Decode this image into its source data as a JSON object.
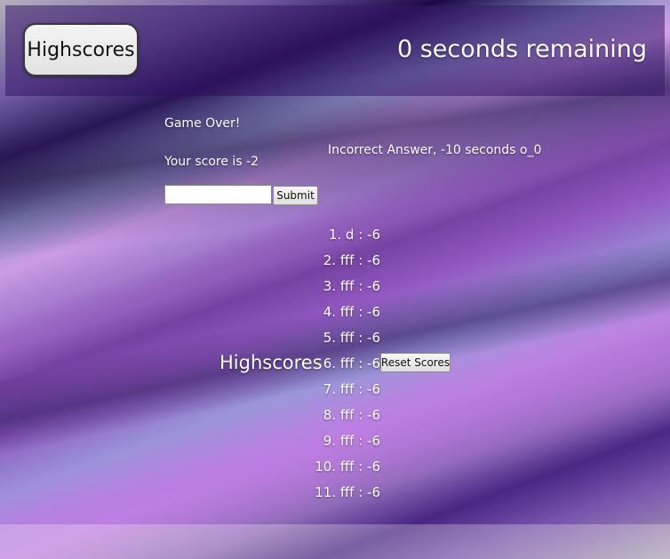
{
  "header": {
    "highscores_button": "Highscores",
    "timer_text": "0 seconds remaining"
  },
  "game": {
    "status": "Game Over!",
    "score_text": "Your score is -2",
    "feedback": "Incorrect Answer, -10 seconds o_0",
    "name_input_value": "",
    "submit_label": "Submit"
  },
  "highscores": {
    "title": "Highscores",
    "reset_label": "Reset Scores",
    "entries": [
      "1. d : -6",
      "2. fff : -6",
      "3. fff : -6",
      "4. fff : -6",
      "5. fff : -6",
      "6. fff : -6",
      "7. fff : -6",
      "8. fff : -6",
      "9. fff : -6",
      "10. fff : -6",
      "11. fff : -6"
    ]
  }
}
